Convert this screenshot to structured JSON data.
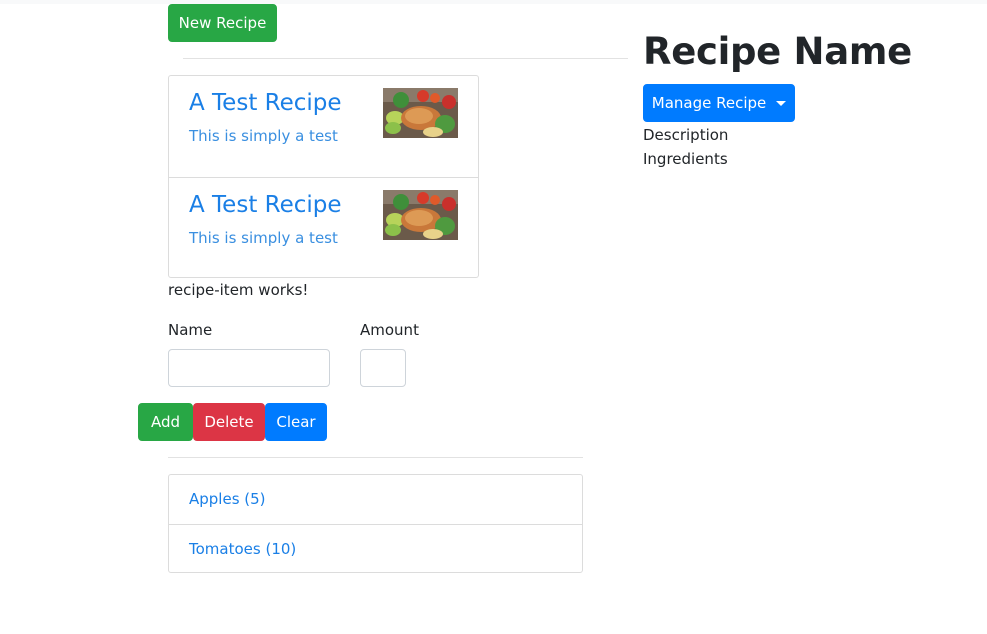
{
  "header": {
    "new_recipe_label": "New Recipe"
  },
  "recipes": [
    {
      "title": "A Test Recipe",
      "description": "This is simply a test",
      "image": "roast-chicken-vegetables"
    },
    {
      "title": "A Test Recipe",
      "description": "This is simply a test",
      "image": "roast-chicken-vegetables"
    }
  ],
  "recipe_item_status": "recipe-item works!",
  "shopping_edit": {
    "name_label": "Name",
    "amount_label": "Amount",
    "name_value": "",
    "amount_value": "",
    "add_label": "Add",
    "delete_label": "Delete",
    "clear_label": "Clear"
  },
  "ingredients": [
    {
      "label": "Apples (5)"
    },
    {
      "label": "Tomatoes (10)"
    }
  ],
  "detail": {
    "title": "Recipe Name",
    "manage_label": "Manage Recipe",
    "description_label": "Description",
    "ingredients_label": "Ingredients"
  },
  "colors": {
    "success": "#28a745",
    "danger": "#dc3545",
    "primary": "#007bff",
    "link": "#1a7fe6"
  }
}
